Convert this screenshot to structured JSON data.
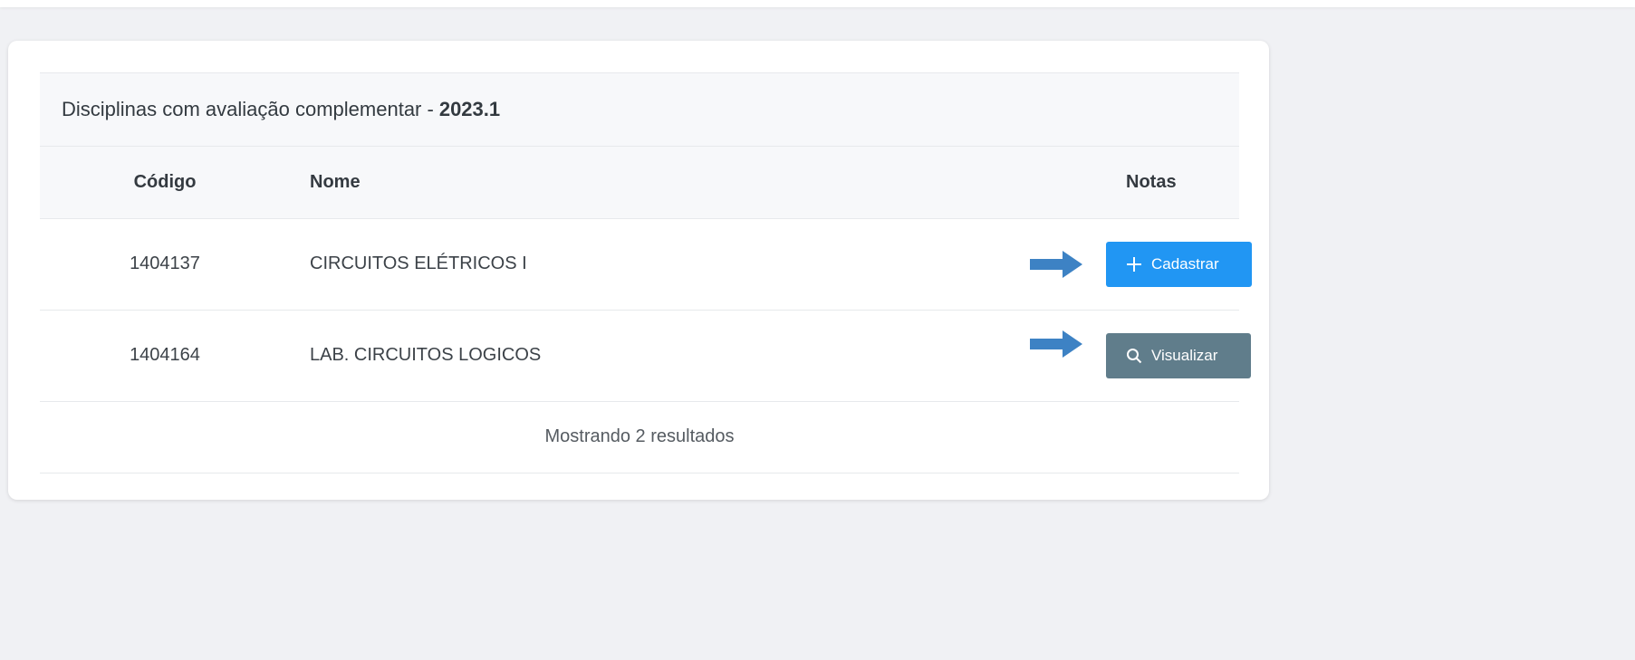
{
  "panel": {
    "title": "Disciplinas com avaliação complementar -",
    "year": "2023.1"
  },
  "table": {
    "headers": {
      "code": "Código",
      "name": "Nome",
      "notes": "Notas"
    },
    "rows": [
      {
        "code": "1404137",
        "name": "CIRCUITOS ELÉTRICOS I",
        "action_label": "Cadastrar",
        "action_icon": "plus-icon",
        "action_color": "#2196f3"
      },
      {
        "code": "1404164",
        "name": "LAB. CIRCUITOS LOGICOS",
        "action_label": "Visualizar",
        "action_icon": "search-icon",
        "action_color": "#607d8b"
      }
    ]
  },
  "footer": {
    "results_text": "Mostrando 2 resultados"
  },
  "colors": {
    "background": "#f0f1f4",
    "arrow": "#3d82c4"
  }
}
